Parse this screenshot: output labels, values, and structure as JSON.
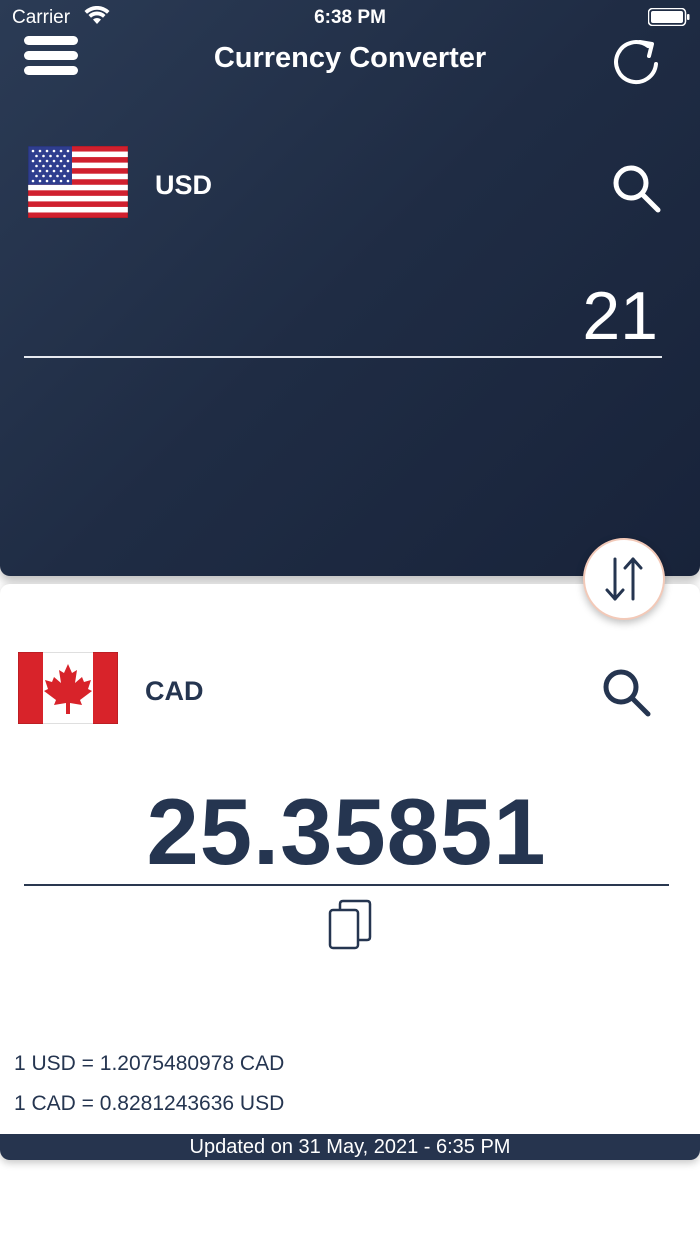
{
  "status_bar": {
    "carrier": "Carrier",
    "time": "6:38 PM"
  },
  "header": {
    "title": "Currency Converter",
    "menu_icon": "hamburger-menu-icon",
    "refresh_icon": "refresh-icon"
  },
  "from": {
    "currency_code": "USD",
    "flag": "us-flag",
    "amount": "21"
  },
  "to": {
    "currency_code": "CAD",
    "flag": "canada-flag",
    "amount": "25.35851"
  },
  "rates": {
    "line1": "1 USD = 1.2075480978 CAD",
    "line2": "1 CAD = 0.8281243636 USD"
  },
  "updated": "Updated on 31 May, 2021 - 6:35 PM",
  "colors": {
    "header_bg": "#1f2c44",
    "text_dark": "#253550",
    "swap_border": "#f2c9b8",
    "flag_red": "#d8232a"
  }
}
